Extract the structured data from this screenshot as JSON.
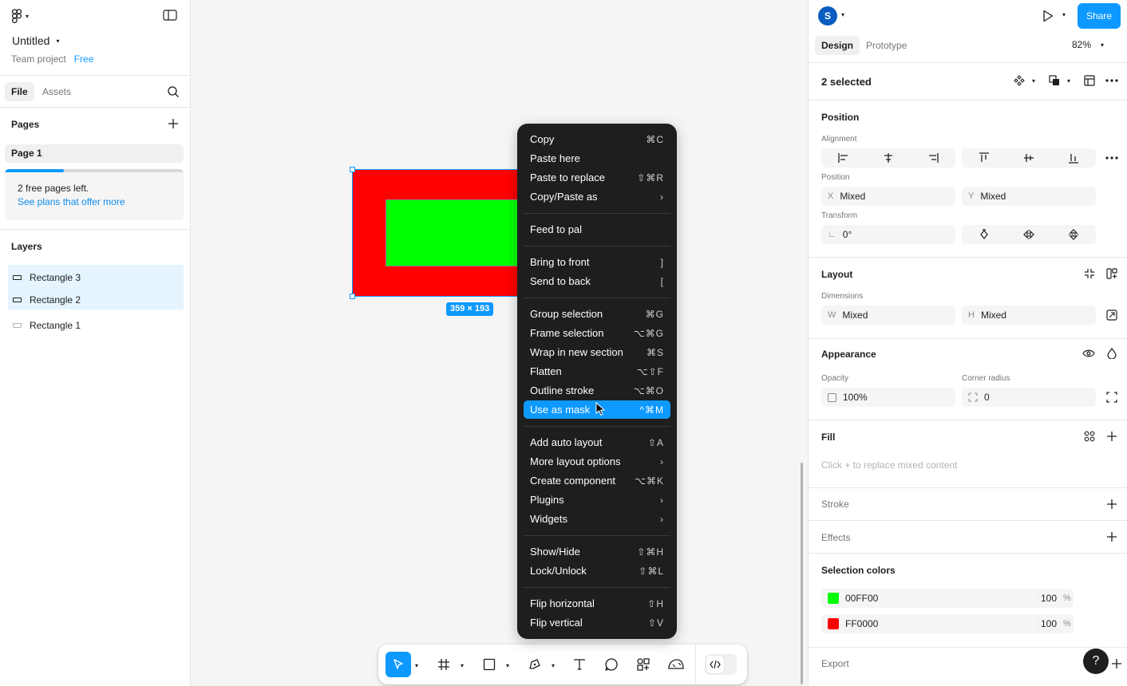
{
  "left_panel": {
    "file_name": "Untitled",
    "team_label": "Team project",
    "plan_label": "Free",
    "tabs": {
      "file": "File",
      "assets": "Assets"
    },
    "pages_title": "Pages",
    "current_page": "Page 1",
    "pages_progress": {
      "used_fraction": 0.33,
      "line1": "2 free pages left.",
      "line2": "See plans that offer more"
    },
    "layers_title": "Layers",
    "layers": [
      {
        "name": "Rectangle 3",
        "selected": true
      },
      {
        "name": "Rectangle 2",
        "selected": true
      },
      {
        "name": "Rectangle 1",
        "selected": false
      }
    ]
  },
  "canvas": {
    "dimension_badge": "359 × 193",
    "shapes": [
      {
        "name": "Rectangle outer",
        "fill": "#FF0000"
      },
      {
        "name": "Rectangle inner",
        "fill": "#00FF00"
      }
    ]
  },
  "context_menu": {
    "items": [
      {
        "label": "Copy",
        "shortcut": "⌘C"
      },
      {
        "label": "Paste here",
        "shortcut": ""
      },
      {
        "label": "Paste to replace",
        "shortcut": "⇧⌘R"
      },
      {
        "label": "Copy/Paste as",
        "shortcut": "›"
      },
      {
        "label": "Feed to pal",
        "shortcut": ""
      },
      {
        "label": "Bring to front",
        "shortcut": "]"
      },
      {
        "label": "Send to back",
        "shortcut": "["
      },
      {
        "label": "Group selection",
        "shortcut": "⌘G"
      },
      {
        "label": "Frame selection",
        "shortcut": "⌥⌘G"
      },
      {
        "label": "Wrap in new section",
        "shortcut": "⌘S"
      },
      {
        "label": "Flatten",
        "shortcut": "⌥⇧F"
      },
      {
        "label": "Outline stroke",
        "shortcut": "⌥⌘O"
      },
      {
        "label": "Use as mask",
        "shortcut": "^⌘M",
        "highlighted": true
      },
      {
        "label": "Add auto layout",
        "shortcut": "⇧A"
      },
      {
        "label": "More layout options",
        "shortcut": "›"
      },
      {
        "label": "Create component",
        "shortcut": "⌥⌘K"
      },
      {
        "label": "Plugins",
        "shortcut": "›"
      },
      {
        "label": "Widgets",
        "shortcut": "›"
      },
      {
        "label": "Show/Hide",
        "shortcut": "⇧⌘H"
      },
      {
        "label": "Lock/Unlock",
        "shortcut": "⇧⌘L"
      },
      {
        "label": "Flip horizontal",
        "shortcut": "⇧H"
      },
      {
        "label": "Flip vertical",
        "shortcut": "⇧V"
      }
    ]
  },
  "right_panel": {
    "avatar_initial": "S",
    "share_label": "Share",
    "tabs": {
      "design": "Design",
      "prototype": "Prototype"
    },
    "zoom": "82%",
    "selection_title": "2 selected",
    "position": {
      "title": "Position",
      "alignment_label": "Alignment",
      "position_label": "Position",
      "x_prefix": "X",
      "x_value": "Mixed",
      "y_prefix": "Y",
      "y_value": "Mixed",
      "transform_label": "Transform",
      "rotation": "0°"
    },
    "layout": {
      "title": "Layout",
      "dimensions_label": "Dimensions",
      "w_prefix": "W",
      "w_value": "Mixed",
      "h_prefix": "H",
      "h_value": "Mixed"
    },
    "appearance": {
      "title": "Appearance",
      "opacity_label": "Opacity",
      "opacity_value": "100%",
      "radius_label": "Corner radius",
      "radius_value": "0"
    },
    "fill": {
      "title": "Fill",
      "hint": "Click + to replace mixed content"
    },
    "stroke_title": "Stroke",
    "effects_title": "Effects",
    "selection_colors": {
      "title": "Selection colors",
      "colors": [
        {
          "hex": "00FF00",
          "swatch": "#00FF00",
          "opacity": "100",
          "unit": "%"
        },
        {
          "hex": "FF0000",
          "swatch": "#FF0000",
          "opacity": "100",
          "unit": "%"
        }
      ]
    },
    "export_title": "Export",
    "help_label": "?"
  },
  "colors": {
    "accent": "#0D99FF",
    "menu_bg": "#1E1E1E"
  }
}
